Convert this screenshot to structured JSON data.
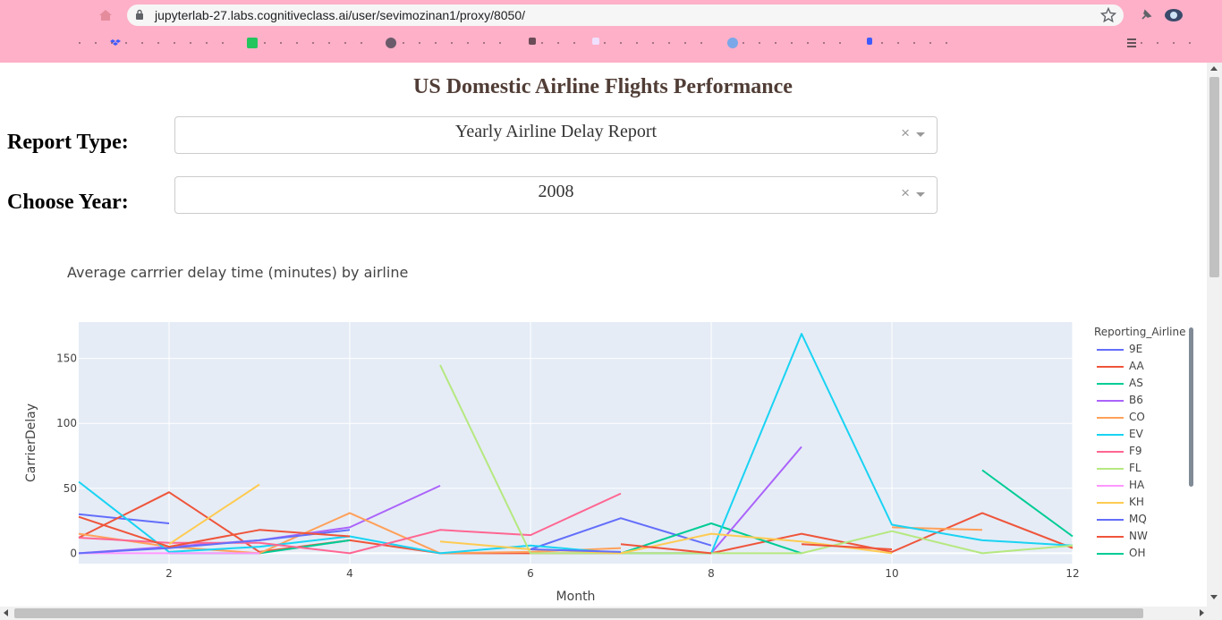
{
  "browser": {
    "url": "jupyterlab-27.labs.cognitiveclass.ai/user/sevimozinan1/proxy/8050/"
  },
  "page": {
    "title": "US Domestic Airline Flights Performance",
    "report_label": "Report Type:",
    "report_value": "Yearly Airline Delay Report",
    "year_label": "Choose Year:",
    "year_value": "2008",
    "clear_symbol": "×"
  },
  "chart_data": {
    "type": "line",
    "title": "Average carrrier delay time (minutes) by airline",
    "xlabel": "Month",
    "ylabel": "CarrierDelay",
    "xlim": [
      1,
      12
    ],
    "ylim": [
      -8,
      178
    ],
    "xticks": [
      2,
      4,
      6,
      8,
      10,
      12
    ],
    "yticks": [
      0,
      50,
      100,
      150
    ],
    "legend_title": "Reporting_Airline",
    "legend_position": "right",
    "series": [
      {
        "name": "9E",
        "color": "#636efa",
        "points": [
          [
            1,
            30
          ],
          [
            2,
            23
          ],
          [
            null,
            null
          ],
          [
            6,
            3
          ],
          [
            7,
            27
          ],
          [
            8,
            6
          ]
        ]
      },
      {
        "name": "AA",
        "color": "#EF553B",
        "points": [
          [
            1,
            12
          ],
          [
            2,
            47
          ],
          [
            3,
            1
          ],
          [
            4,
            10
          ],
          [
            5,
            0
          ],
          [
            6,
            0
          ],
          [
            7,
            0
          ],
          [
            8,
            0
          ],
          [
            9,
            15
          ],
          [
            10,
            1
          ],
          [
            11,
            31
          ],
          [
            12,
            4
          ]
        ]
      },
      {
        "name": "AS",
        "color": "#00cc96",
        "points": [
          [
            2,
            0
          ],
          [
            3,
            0
          ],
          [
            4,
            10
          ],
          [
            null,
            null
          ],
          [
            7,
            0
          ],
          [
            8,
            23
          ],
          [
            9,
            0
          ]
        ]
      },
      {
        "name": "B6",
        "color": "#ab63fa",
        "points": [
          [
            1,
            0
          ],
          [
            2,
            5
          ],
          [
            3,
            10
          ],
          [
            4,
            20
          ],
          [
            5,
            52
          ],
          [
            null,
            null
          ],
          [
            8,
            0
          ],
          [
            9,
            82
          ]
        ]
      },
      {
        "name": "CO",
        "color": "#FFA15A",
        "points": [
          [
            1,
            15
          ],
          [
            2,
            5
          ],
          [
            3,
            0
          ],
          [
            4,
            31
          ],
          [
            5,
            0
          ],
          [
            6,
            1
          ],
          [
            7,
            4
          ],
          [
            null,
            null
          ],
          [
            10,
            20
          ],
          [
            11,
            18
          ]
        ]
      },
      {
        "name": "EV",
        "color": "#19d3f3",
        "points": [
          [
            1,
            55
          ],
          [
            2,
            1
          ],
          [
            3,
            5
          ],
          [
            4,
            13
          ],
          [
            5,
            0
          ],
          [
            6,
            6
          ],
          [
            7,
            0
          ],
          [
            8,
            0
          ],
          [
            9,
            169
          ],
          [
            10,
            22
          ],
          [
            11,
            10
          ],
          [
            12,
            6
          ]
        ]
      },
      {
        "name": "F9",
        "color": "#FF6692",
        "points": [
          [
            1,
            12
          ],
          [
            2,
            8
          ],
          [
            3,
            8
          ],
          [
            4,
            0
          ],
          [
            5,
            18
          ],
          [
            6,
            14
          ],
          [
            7,
            46
          ]
        ]
      },
      {
        "name": "FL",
        "color": "#B6E880",
        "points": [
          [
            5,
            145
          ],
          [
            6,
            0
          ],
          [
            7,
            0
          ],
          [
            8,
            0
          ],
          [
            9,
            0
          ],
          [
            10,
            17
          ],
          [
            11,
            0
          ],
          [
            12,
            6
          ]
        ]
      },
      {
        "name": "HA",
        "color": "#FF97FF",
        "points": [
          [
            1,
            0
          ],
          [
            2,
            0
          ],
          [
            3,
            0
          ]
        ]
      },
      {
        "name": "KH",
        "color": "#FECB52",
        "points": [
          [
            2,
            7
          ],
          [
            3,
            53
          ],
          [
            null,
            null
          ],
          [
            5,
            9
          ],
          [
            6,
            3
          ],
          [
            7,
            0
          ],
          [
            8,
            15
          ],
          [
            9,
            9
          ],
          [
            10,
            0
          ]
        ]
      },
      {
        "name": "MQ",
        "color": "#636efa",
        "points": [
          [
            1,
            0
          ],
          [
            2,
            4
          ],
          [
            3,
            10
          ],
          [
            4,
            18
          ],
          [
            null,
            null
          ],
          [
            6,
            3
          ],
          [
            7,
            1
          ]
        ]
      },
      {
        "name": "NW",
        "color": "#EF553B",
        "points": [
          [
            1,
            28
          ],
          [
            2,
            5
          ],
          [
            3,
            18
          ],
          [
            4,
            13
          ],
          [
            null,
            null
          ],
          [
            7,
            7
          ],
          [
            8,
            0
          ],
          [
            null,
            null
          ],
          [
            9,
            7
          ],
          [
            10,
            3
          ]
        ]
      },
      {
        "name": "OH",
        "color": "#00cc96",
        "points": [
          [
            11,
            64
          ],
          [
            12,
            13
          ]
        ]
      }
    ]
  }
}
